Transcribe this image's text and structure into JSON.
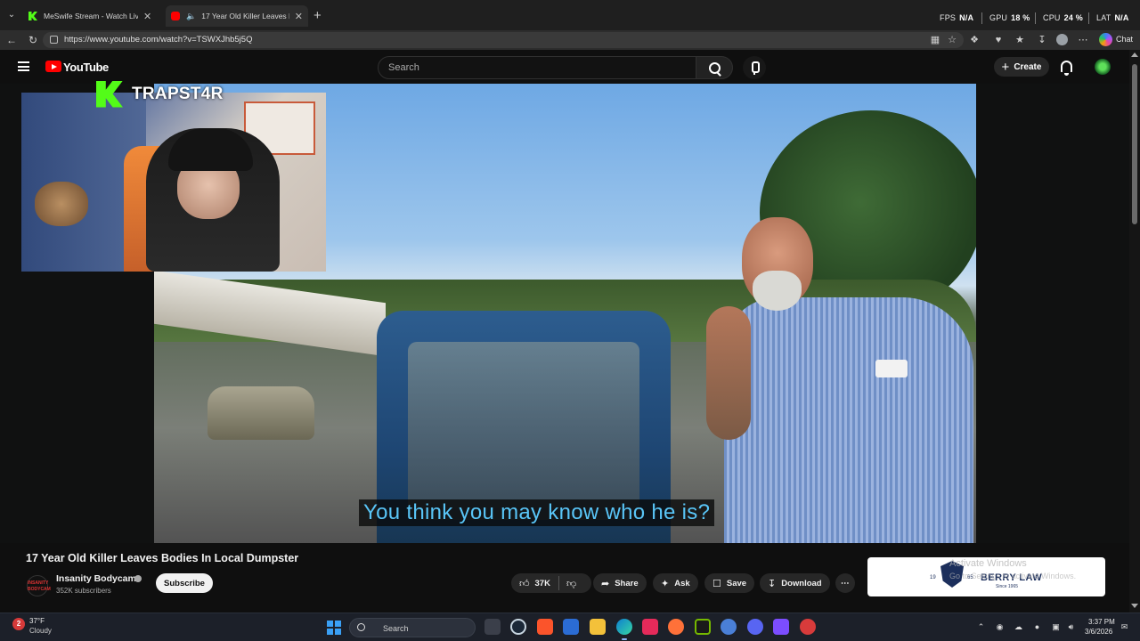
{
  "browser": {
    "tabs": [
      {
        "label": "MeSwife Stream - Watch Live",
        "icon": "kick-favicon"
      },
      {
        "label": "17 Year Old Killer Leaves Bodie",
        "icon": "youtube-favicon",
        "audio": true
      }
    ],
    "url": "https://www.youtube.com/watch?v=TSWXJhb5j5Q",
    "chat_label": "Chat",
    "perf": {
      "fps_label": "FPS",
      "fps_value": "N/A",
      "gpu_label": "GPU",
      "gpu_value": "18 %",
      "cpu_label": "CPU",
      "cpu_value": "24 %",
      "lat_label": "LAT",
      "lat_value": "N/A"
    }
  },
  "youtube": {
    "logo_text": "YouTube",
    "search_placeholder": "Search",
    "create_label": "Create"
  },
  "stream_overlay": {
    "streamer_name": "TRAPST4R",
    "kick_color": "#53fc18"
  },
  "video": {
    "caption": "You think you may know who he is?",
    "caption_color": "#59c5f7",
    "title": "17 Year Old Killer Leaves Bodies In Local Dumpster",
    "channel_avatar_text": "INSANITY BODYCAM",
    "channel_name": "Insanity Bodycam",
    "subscribers": "352K subscribers",
    "subscribe_label": "Subscribe",
    "like_count": "37K",
    "share_label": "Share",
    "ask_label": "Ask",
    "save_label": "Save",
    "download_label": "Download"
  },
  "ad": {
    "brand": "BERRY LAW",
    "year_left": "19",
    "year_right": "65",
    "since": "Since 1965"
  },
  "watermark": {
    "line1": "Activate Windows",
    "line2": "Go to Settings to activate Windows."
  },
  "taskbar": {
    "weather_badge": "2",
    "temperature": "37°F",
    "condition": "Cloudy",
    "search_label": "Search",
    "time": "3:37 PM",
    "date": "3/6/2026"
  }
}
